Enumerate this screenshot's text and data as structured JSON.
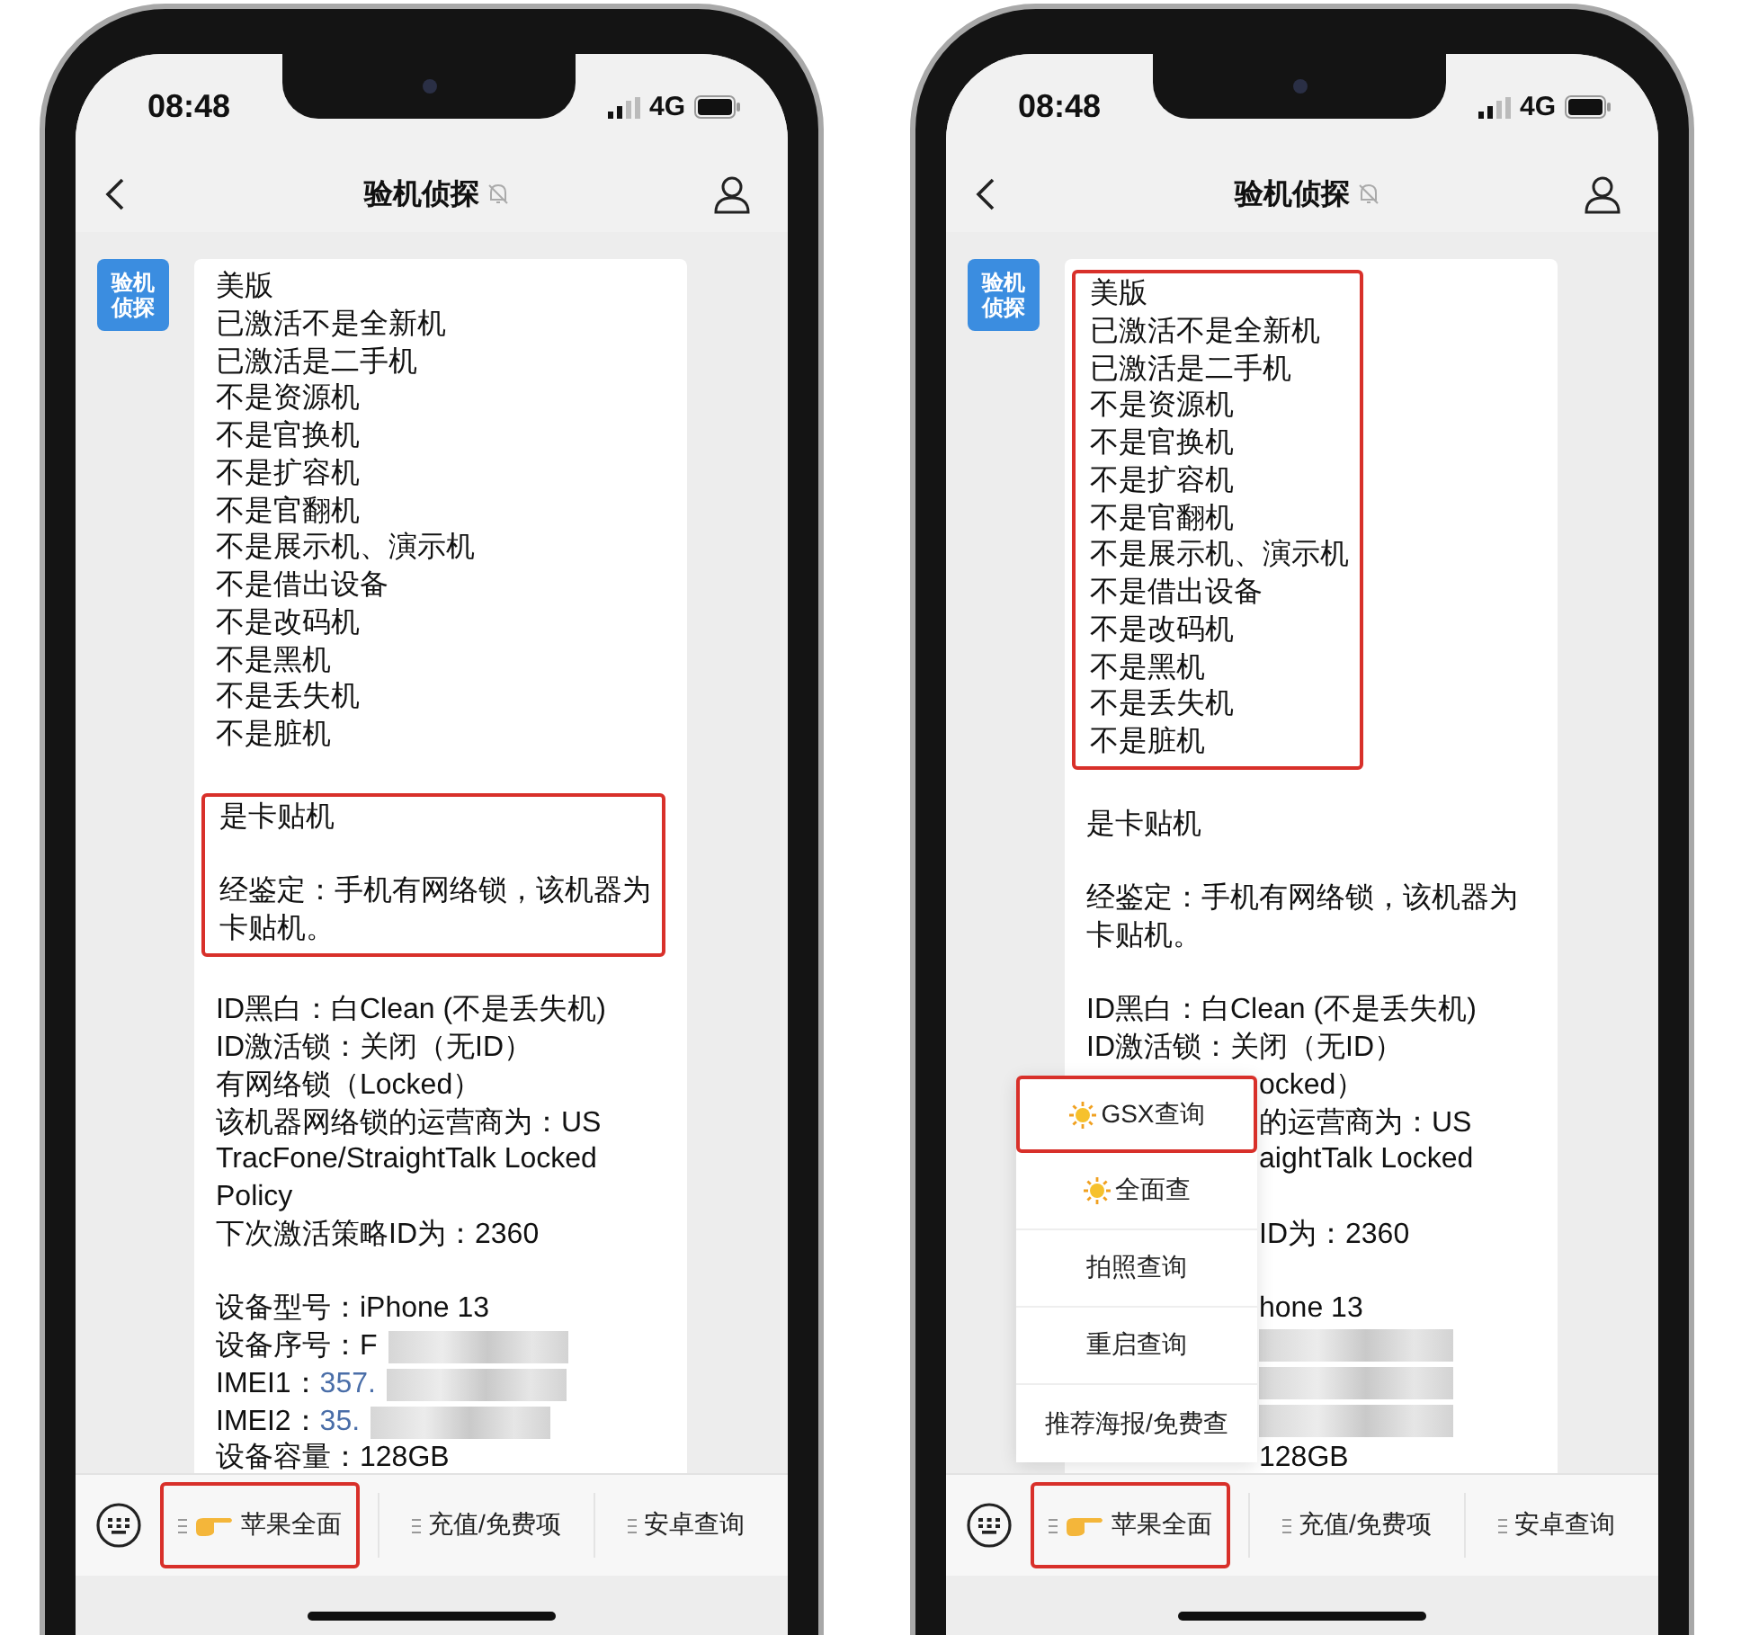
{
  "phones": [
    {
      "status_bar": {
        "time": "08:48",
        "network": "4G"
      },
      "nav": {
        "title": "验机侦探",
        "muted": true
      },
      "avatar_text": [
        "验机",
        "侦探"
      ],
      "sections": [
        {
          "highlighted": false,
          "paragraphs": [
            [
              {
                "kind": "text",
                "text": "美版"
              },
              {
                "kind": "text",
                "text": "已激活不是全新机"
              },
              {
                "kind": "text",
                "text": "已激活是二手机"
              },
              {
                "kind": "text",
                "text": "不是资源机"
              },
              {
                "kind": "text",
                "text": "不是官换机"
              },
              {
                "kind": "text",
                "text": "不是扩容机"
              },
              {
                "kind": "text",
                "text": "不是官翻机"
              },
              {
                "kind": "text",
                "text": "不是展示机、演示机"
              },
              {
                "kind": "text",
                "text": "不是借出设备"
              },
              {
                "kind": "text",
                "text": "不是改码机"
              },
              {
                "kind": "text",
                "text": "不是黑机"
              },
              {
                "kind": "text",
                "text": "不是丢失机"
              },
              {
                "kind": "text",
                "text": "不是脏机"
              }
            ]
          ]
        },
        {
          "highlighted": true,
          "paragraphs": [
            [
              {
                "kind": "text",
                "text": "是卡贴机"
              }
            ],
            [
              {
                "kind": "text",
                "text": "经鉴定：手机有网络锁，该机器为"
              },
              {
                "kind": "text",
                "text": "卡贴机。"
              }
            ]
          ]
        },
        {
          "highlighted": false,
          "paragraphs": [
            [
              {
                "kind": "text",
                "text": "ID黑白：白Clean (不是丢失机)"
              },
              {
                "kind": "text",
                "text": "ID激活锁：关闭（无ID）"
              },
              {
                "kind": "text",
                "text": "有网络锁（Locked）"
              },
              {
                "kind": "text",
                "text": "该机器网络锁的运营商为：US"
              },
              {
                "kind": "text",
                "text": "TracFone/StraightTalk Locked"
              },
              {
                "kind": "text",
                "text": "Policy"
              },
              {
                "kind": "text",
                "text": "下次激活策略ID为：2360"
              }
            ],
            [
              {
                "kind": "text",
                "text": "设备型号：iPhone 13"
              },
              {
                "kind": "masked",
                "label": "设备序号：",
                "value": "F",
                "link": false
              },
              {
                "kind": "masked",
                "label": "IMEI1：",
                "value": "357.",
                "link": true
              },
              {
                "kind": "masked",
                "label": "IMEI2：",
                "value": "35.",
                "link": true
              },
              {
                "kind": "text",
                "text": "设备容量：128GB"
              }
            ]
          ]
        }
      ],
      "bottom_menu": [
        {
          "label": "苹果全面",
          "kind": "hand",
          "highlighted": true
        },
        {
          "label": "充值/免费项",
          "kind": "plain",
          "highlighted": false
        },
        {
          "label": "安卓查询",
          "kind": "plain",
          "highlighted": false
        }
      ]
    },
    {
      "status_bar": {
        "time": "08:48",
        "network": "4G"
      },
      "nav": {
        "title": "验机侦探",
        "muted": true
      },
      "avatar_text": [
        "验机",
        "侦探"
      ],
      "sections": [
        {
          "highlighted": true,
          "paragraphs": [
            [
              {
                "kind": "text",
                "text": "美版"
              },
              {
                "kind": "text",
                "text": "已激活不是全新机"
              },
              {
                "kind": "text",
                "text": "已激活是二手机"
              },
              {
                "kind": "text",
                "text": "不是资源机"
              },
              {
                "kind": "text",
                "text": "不是官换机"
              },
              {
                "kind": "text",
                "text": "不是扩容机"
              },
              {
                "kind": "text",
                "text": "不是官翻机"
              },
              {
                "kind": "text",
                "text": "不是展示机、演示机"
              },
              {
                "kind": "text",
                "text": "不是借出设备"
              },
              {
                "kind": "text",
                "text": "不是改码机"
              },
              {
                "kind": "text",
                "text": "不是黑机"
              },
              {
                "kind": "text",
                "text": "不是丢失机"
              },
              {
                "kind": "text",
                "text": "不是脏机"
              }
            ]
          ]
        },
        {
          "highlighted": false,
          "paragraphs": [
            [
              {
                "kind": "text",
                "text": "是卡贴机"
              }
            ],
            [
              {
                "kind": "text",
                "text": "经鉴定：手机有网络锁，该机器为"
              },
              {
                "kind": "text",
                "text": "卡贴机。"
              }
            ]
          ]
        },
        {
          "highlighted": false,
          "paragraphs": [
            [
              {
                "kind": "text",
                "text": "ID黑白：白Clean (不是丢失机)"
              },
              {
                "kind": "text",
                "text": "ID激活锁：关闭（无ID）"
              }
            ]
          ],
          "beside_menu": [
            {
              "kind": "text",
              "text": "ocked）"
            },
            {
              "kind": "text",
              "text": "的运营商为：US"
            },
            {
              "kind": "text",
              "text": "aightTalk Locked"
            },
            {
              "kind": "gap"
            },
            {
              "kind": "text",
              "text": "ID为：2360"
            },
            {
              "kind": "gap"
            },
            {
              "kind": "text",
              "text": "hone 13"
            },
            {
              "kind": "blurred"
            },
            {
              "kind": "blurred"
            },
            {
              "kind": "blurred"
            },
            {
              "kind": "text",
              "text": "128GB"
            }
          ]
        }
      ],
      "popup_menu": [
        {
          "label": "GSX查询",
          "kind": "sun",
          "highlighted": true
        },
        {
          "label": "全面查",
          "kind": "sun",
          "highlighted": false
        },
        {
          "label": "拍照查询",
          "kind": "plain",
          "highlighted": false
        },
        {
          "label": "重启查询",
          "kind": "plain",
          "highlighted": false
        },
        {
          "label": "推荐海报/免费查",
          "kind": "plain",
          "highlighted": false
        }
      ],
      "bottom_menu": [
        {
          "label": "苹果全面",
          "kind": "hand",
          "highlighted": true
        },
        {
          "label": "充值/免费项",
          "kind": "plain",
          "highlighted": false
        },
        {
          "label": "安卓查询",
          "kind": "plain",
          "highlighted": false
        }
      ]
    }
  ]
}
